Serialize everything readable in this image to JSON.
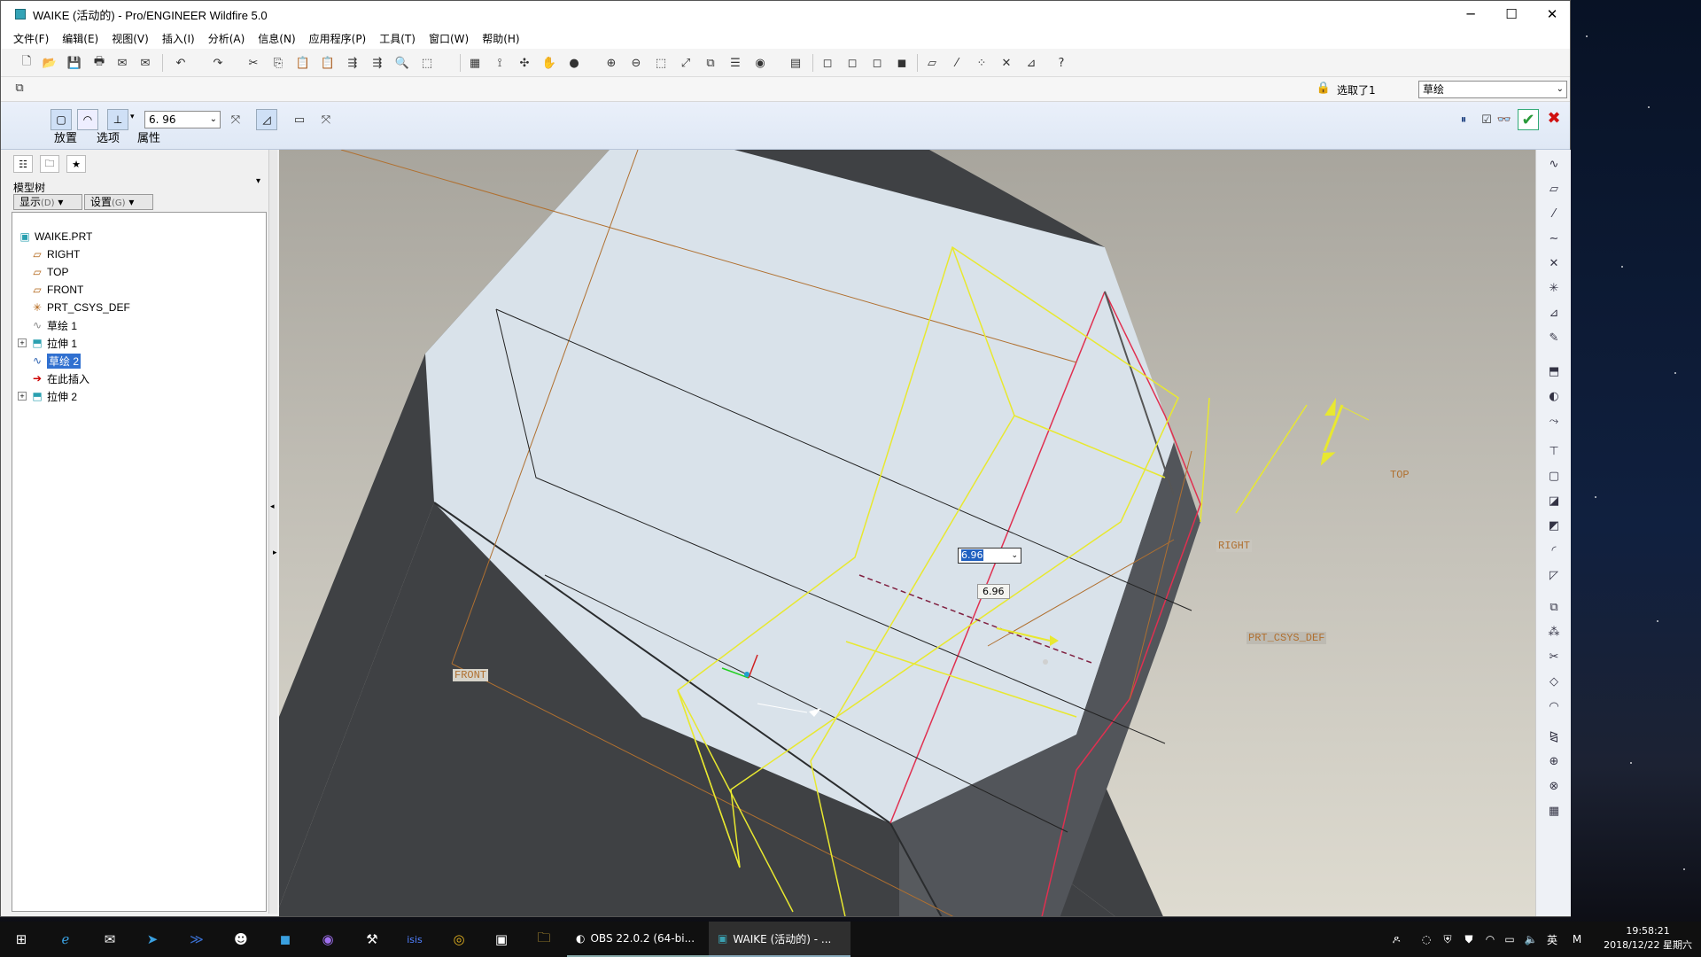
{
  "window": {
    "title": "WAIKE (活动的) - Pro/ENGINEER Wildfire 5.0",
    "min": "─",
    "max": "☐",
    "close": "✕"
  },
  "menu": [
    "文件(F)",
    "编辑(E)",
    "视图(V)",
    "插入(I)",
    "分析(A)",
    "信息(N)",
    "应用程序(P)",
    "工具(T)",
    "窗口(W)",
    "帮助(H)"
  ],
  "status": {
    "selected": "选取了1",
    "filter": "草绘"
  },
  "dashboard": {
    "tabs": [
      "放置",
      "选项",
      "属性"
    ],
    "depth_value": "6. 96",
    "depth_icon": "blind-depth-icon"
  },
  "model_tree": {
    "header": "模型树",
    "show_btn": "显示",
    "show_key": "(D)",
    "settings_btn": "设置",
    "settings_key": "(G)",
    "items": [
      {
        "label": "WAIKE.PRT",
        "icon": "part-icon"
      },
      {
        "label": "RIGHT",
        "icon": "datum-plane-icon"
      },
      {
        "label": "TOP",
        "icon": "datum-plane-icon"
      },
      {
        "label": "FRONT",
        "icon": "datum-plane-icon"
      },
      {
        "label": "PRT_CSYS_DEF",
        "icon": "csys-icon"
      },
      {
        "label": "草绘 1",
        "icon": "sketch-icon"
      },
      {
        "label": "拉伸 1",
        "icon": "extrude-icon"
      },
      {
        "label": "草绘 2",
        "icon": "sketch-icon"
      },
      {
        "label": "在此插入",
        "icon": "insert-here-icon"
      },
      {
        "label": "拉伸 2",
        "icon": "extrude-icon"
      }
    ]
  },
  "viewport": {
    "labels": {
      "top": "TOP",
      "right": "RIGHT",
      "front": "FRONT",
      "csys": "PRT_CSYS_DEF"
    },
    "dim_input": "6.96",
    "dim_label": "6.96"
  },
  "taskbar": {
    "apps": [
      "OBS 22.0.2 (64-bi...",
      "WAIKE (活动的) - ..."
    ],
    "lang": "英",
    "time": "19:58:21",
    "date": "2018/12/22 星期六"
  }
}
